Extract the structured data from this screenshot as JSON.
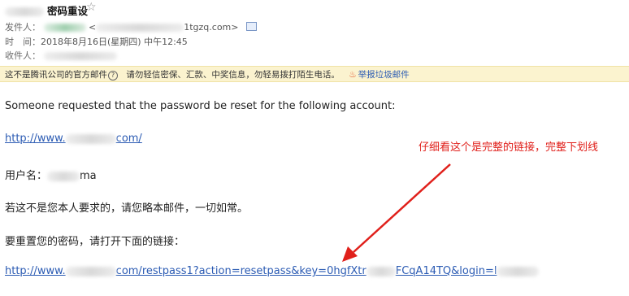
{
  "header": {
    "subject": "密码重设",
    "star_icon": "star-outline-icon",
    "sender_label": "发件人：",
    "sender_email_suffix": "1tgzq.com>",
    "time_label": "时　间：",
    "time_value": "2018年8月16日(星期四) 中午12:45",
    "recipient_label": "收件人："
  },
  "notice": {
    "text": "这不是腾讯公司的官方邮件",
    "help_icon": "?",
    "warning": "请勿轻信密保、汇款、中奖信息，勿轻易拨打陌生电话。",
    "report_label": "举报垃圾邮件"
  },
  "body": {
    "line1": "Someone requested that the password be reset for the following account:",
    "site_link_start": "http://www.",
    "site_link_end": "com/",
    "username_label": "用户名：",
    "username_tail": "ma",
    "line_ignore": "若这不是您本人要求的，请您略本邮件，一切如常。",
    "line_reset": "要重置您的密码，请打开下面的链接：",
    "reset_link_start": "http://www.",
    "reset_link_mid": "com/restpass1?action=resetpass&key=0hgfXtr",
    "reset_link_end": "FCqA14TQ&login=l"
  },
  "annotation": {
    "text": "仔细看这个是完整的链接，完整下划线",
    "color": "#e0201b"
  }
}
